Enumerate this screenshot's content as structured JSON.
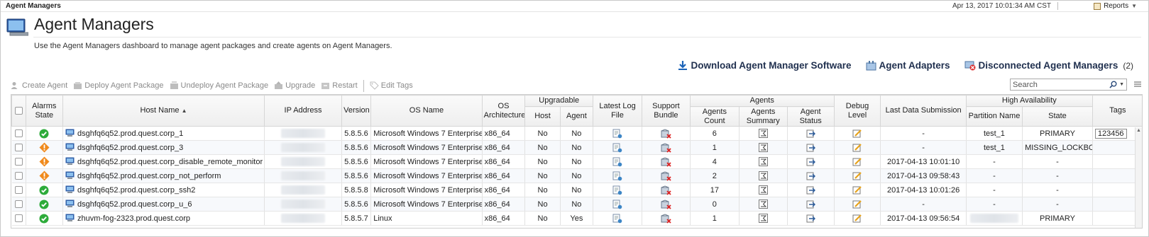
{
  "breadcrumb": "Agent Managers",
  "datetime": "Apr 13, 2017 10:01:34 AM CST",
  "reports_label": "Reports",
  "page": {
    "title": "Agent Managers",
    "description": "Use the Agent Managers dashboard to manage agent packages and create agents on Agent Managers."
  },
  "links": {
    "download": "Download Agent Manager Software",
    "adapters": "Agent Adapters",
    "disconnected": "Disconnected Agent Managers",
    "disconnected_count": "(2)"
  },
  "toolbar": {
    "create_agent": "Create Agent",
    "deploy": "Deploy Agent Package",
    "undeploy": "Undeploy Agent Package",
    "upgrade": "Upgrade",
    "restart": "Restart",
    "edit_tags": "Edit Tags"
  },
  "search": {
    "placeholder": "Search"
  },
  "columns": {
    "alarms_state": "Alarms State",
    "host_name": "Host Name",
    "ip_address": "IP Address",
    "version": "Version",
    "os_name": "OS Name",
    "os_arch": "OS Architecture",
    "upgradable": "Upgradable",
    "up_host": "Host",
    "up_agent": "Agent",
    "latest_log": "Latest Log File",
    "support_bundle": "Support Bundle",
    "agents": "Agents",
    "agents_count": "Agents Count",
    "agents_summary": "Agents Summary",
    "agent_status": "Agent Status",
    "debug_level": "Debug Level",
    "last_data": "Last Data Submission",
    "high_availability": "High Availability",
    "partition_name": "Partition Name",
    "ha_state": "State",
    "tags": "Tags"
  },
  "colors": {
    "ok": "#2dab3a",
    "warning": "#f08a1c",
    "link": "#1f2f4e"
  },
  "rows": [
    {
      "alarm": "ok",
      "host": "dsghfq6q52.prod.quest.corp_1",
      "version": "5.8.5.6",
      "os": "Microsoft Windows 7 Enterprise",
      "arch": "x86_64",
      "up_host": "No",
      "up_agent": "No",
      "count": "6",
      "last": "-",
      "partition": "test_1",
      "state": "PRIMARY",
      "tags": "123456"
    },
    {
      "alarm": "warning",
      "host": "dsghfq6q52.prod.quest.corp_3",
      "version": "5.8.5.6",
      "os": "Microsoft Windows 7 Enterprise",
      "arch": "x86_64",
      "up_host": "No",
      "up_agent": "No",
      "count": "1",
      "last": "-",
      "partition": "test_1",
      "state": "MISSING_LOCKBOX",
      "tags": ""
    },
    {
      "alarm": "warning",
      "host": "dsghfq6q52.prod.quest.corp_disable_remote_monitor",
      "version": "5.8.5.6",
      "os": "Microsoft Windows 7 Enterprise",
      "arch": "x86_64",
      "up_host": "No",
      "up_agent": "No",
      "count": "4",
      "last": "2017-04-13 10:01:10",
      "partition": "-",
      "state": "-",
      "tags": ""
    },
    {
      "alarm": "warning",
      "host": "dsghfq6q52.prod.quest.corp_not_perform",
      "version": "5.8.5.6",
      "os": "Microsoft Windows 7 Enterprise",
      "arch": "x86_64",
      "up_host": "No",
      "up_agent": "No",
      "count": "2",
      "last": "2017-04-13 09:58:43",
      "partition": "-",
      "state": "-",
      "tags": ""
    },
    {
      "alarm": "ok",
      "host": "dsghfq6q52.prod.quest.corp_ssh2",
      "version": "5.8.5.8",
      "os": "Microsoft Windows 7 Enterprise",
      "arch": "x86_64",
      "up_host": "No",
      "up_agent": "No",
      "count": "17",
      "last": "2017-04-13 10:01:26",
      "partition": "-",
      "state": "-",
      "tags": ""
    },
    {
      "alarm": "ok",
      "host": "dsghfq6q52.prod.quest.corp_u_6",
      "version": "5.8.5.6",
      "os": "Microsoft Windows 7 Enterprise",
      "arch": "x86_64",
      "up_host": "No",
      "up_agent": "No",
      "count": "0",
      "last": "-",
      "partition": "-",
      "state": "-",
      "tags": ""
    },
    {
      "alarm": "ok",
      "host": "zhuvm-fog-2323.prod.quest.corp",
      "version": "5.8.5.7",
      "os": "Linux",
      "arch": "x86_64",
      "up_host": "No",
      "up_agent": "Yes",
      "count": "1",
      "last": "2017-04-13 09:56:54",
      "partition": "",
      "state": "PRIMARY",
      "tags": ""
    }
  ]
}
